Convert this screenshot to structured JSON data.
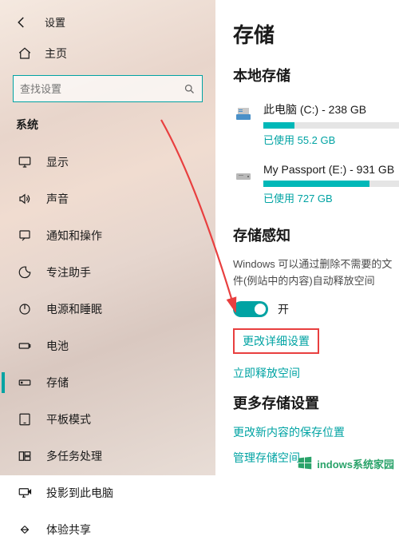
{
  "header": {
    "title": "设置"
  },
  "home": {
    "label": "主页"
  },
  "search": {
    "placeholder": "查找设置"
  },
  "section_title": "系统",
  "nav": [
    {
      "icon": "display",
      "label": "显示"
    },
    {
      "icon": "sound",
      "label": "声音"
    },
    {
      "icon": "notify",
      "label": "通知和操作"
    },
    {
      "icon": "focus",
      "label": "专注助手"
    },
    {
      "icon": "power",
      "label": "电源和睡眠"
    },
    {
      "icon": "battery",
      "label": "电池"
    },
    {
      "icon": "storage",
      "label": "存储",
      "selected": true
    },
    {
      "icon": "tablet",
      "label": "平板模式"
    },
    {
      "icon": "multi",
      "label": "多任务处理"
    },
    {
      "icon": "project",
      "label": "投影到此电脑"
    },
    {
      "icon": "shared",
      "label": "体验共享"
    }
  ],
  "page_title": "存储",
  "local_storage": {
    "title": "本地存储",
    "drives": [
      {
        "name": "此电脑 (C:) - 238 GB",
        "fill_pct": 23,
        "used": "已使用 55.2 GB"
      },
      {
        "name": "My Passport (E:) - 931 GB",
        "fill_pct": 78,
        "used": "已使用 727 GB"
      }
    ]
  },
  "storage_sense": {
    "title": "存储感知",
    "desc": "Windows 可以通过删除不需要的文件(例站中的内容)自动释放空间",
    "toggle_label": "开",
    "link_detail": "更改详细设置",
    "link_free": "立即释放空间"
  },
  "more_storage": {
    "title": "更多存储设置",
    "link_location": "更改新内容的保存位置",
    "link_manage": "管理存储空间"
  },
  "watermark": {
    "text": "indows系统家园"
  }
}
